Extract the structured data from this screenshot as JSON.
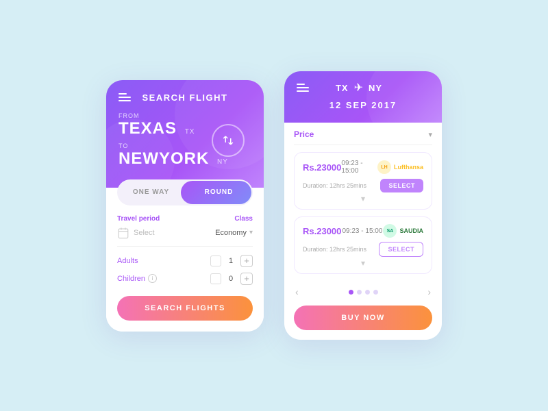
{
  "left_card": {
    "title": "SEARCH FLIGHT",
    "from_label": "From",
    "from_city": "TEXAS",
    "from_code": "TX",
    "to_label": "To",
    "to_city": "NEWYORK",
    "to_code": "NY",
    "toggle": {
      "one_way": "ONE WAY",
      "round": "ROUND"
    },
    "form": {
      "travel_period_label": "Travel period",
      "class_label": "Class",
      "select_placeholder": "Select",
      "class_value": "Economy",
      "adults_label": "Adults",
      "adults_count": "1",
      "children_label": "Children",
      "children_count": "0"
    },
    "search_btn": "SEARCH FLIGHTS"
  },
  "right_card": {
    "route_from": "TX",
    "route_to": "NY",
    "date": "12 SEP 2017",
    "filter_label": "Price",
    "flights": [
      {
        "price": "Rs.23000",
        "time": "09:23 - 15:00",
        "airline": "Lufthansa",
        "airline_type": "lufthansa",
        "duration": "Duration: 12hrs 25mins",
        "select_label": "SELECT",
        "btn_style": "purple"
      },
      {
        "price": "Rs.23000",
        "time": "09:23 - 15:00",
        "airline": "SAUDIA",
        "airline_type": "saudia",
        "duration": "Duration: 12hrs 25mins",
        "select_label": "SELECT",
        "btn_style": "outline"
      }
    ],
    "pagination": {
      "dots": [
        true,
        false,
        false,
        false
      ],
      "prev_arrow": "‹",
      "next_arrow": "›"
    },
    "buy_btn": "BUY NOW"
  }
}
